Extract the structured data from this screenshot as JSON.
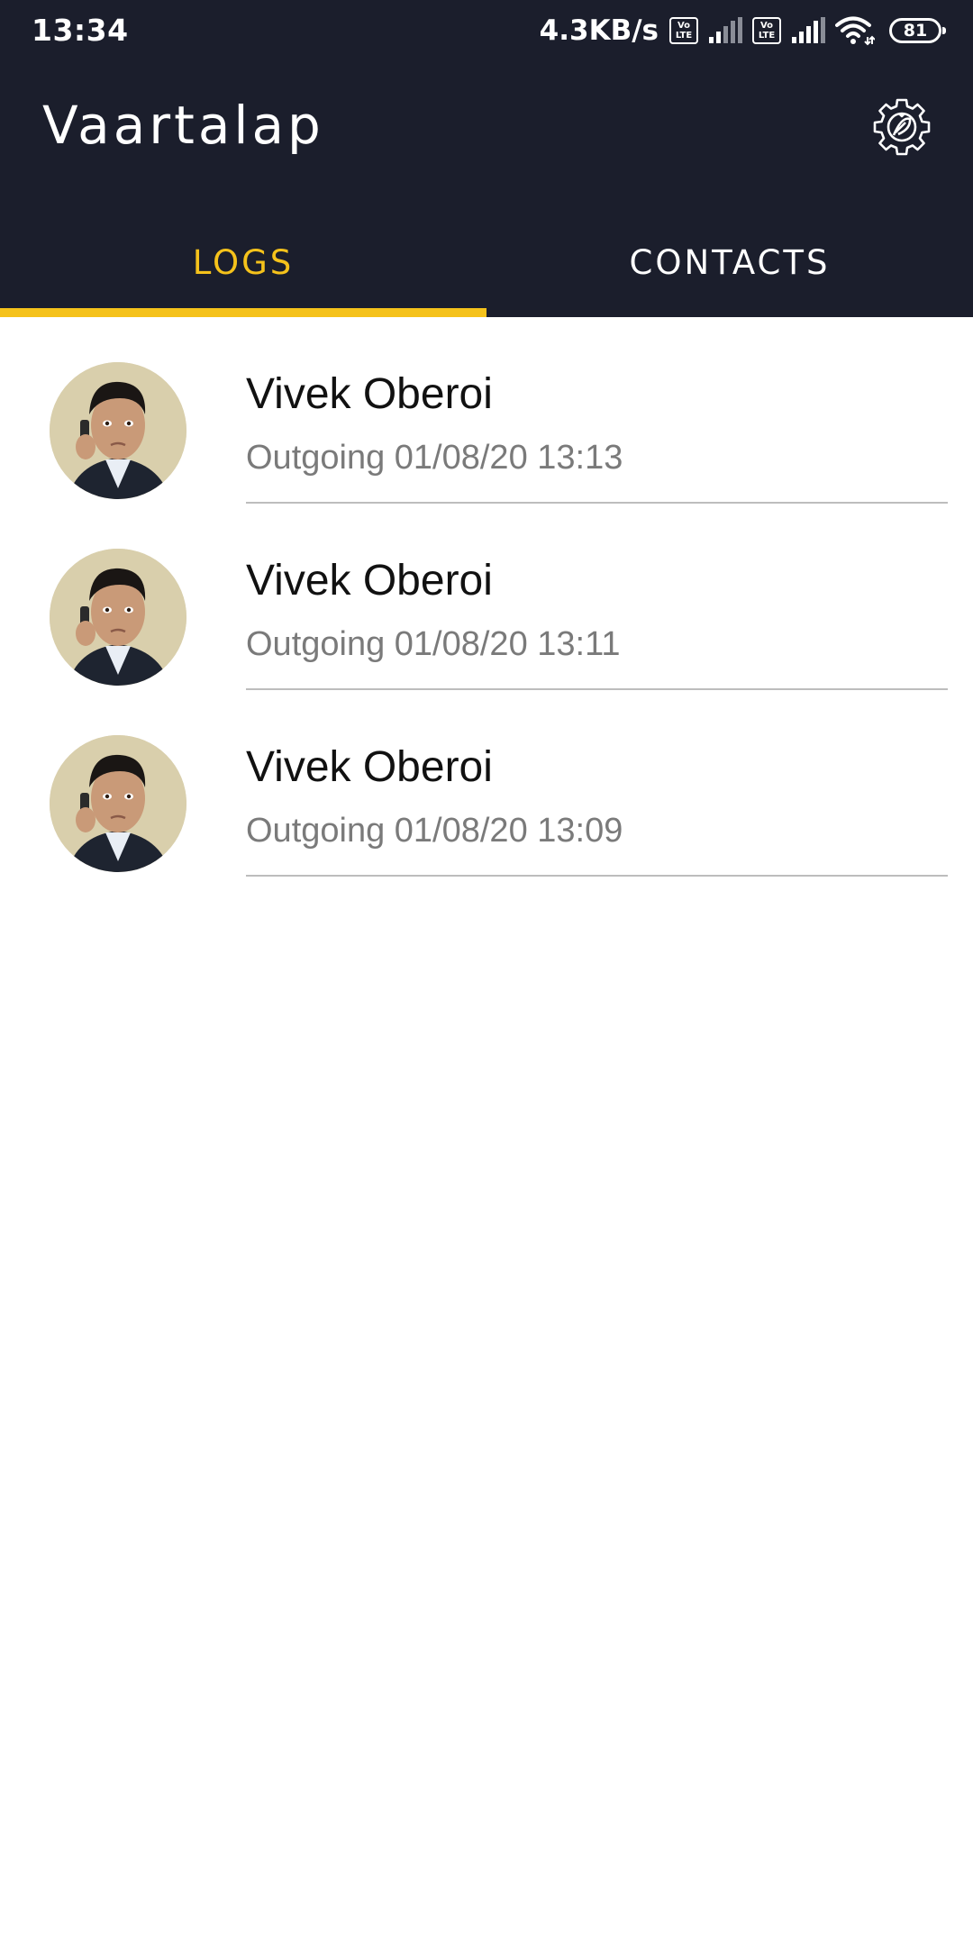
{
  "status_bar": {
    "time": "13:34",
    "net_speed": "4.3KB/s",
    "volte_top": "Vo",
    "volte_bottom": "LTE",
    "battery_level": "81"
  },
  "toolbar": {
    "title": "Vaartalap",
    "settings_icon": "settings-gear-icon"
  },
  "tabs": [
    {
      "label": "LOGS",
      "active": true
    },
    {
      "label": "CONTACTS",
      "active": false
    }
  ],
  "call_logs": [
    {
      "name": "Vivek Oberoi",
      "detail": "Outgoing 01/08/20 13:13"
    },
    {
      "name": "Vivek Oberoi",
      "detail": "Outgoing 01/08/20 13:11"
    },
    {
      "name": "Vivek Oberoi",
      "detail": "Outgoing 01/08/20 13:09"
    }
  ],
  "colors": {
    "header_bg": "#1b1e2c",
    "accent": "#f5c21b",
    "text_primary": "#111111",
    "text_secondary": "#7a7a7a"
  }
}
